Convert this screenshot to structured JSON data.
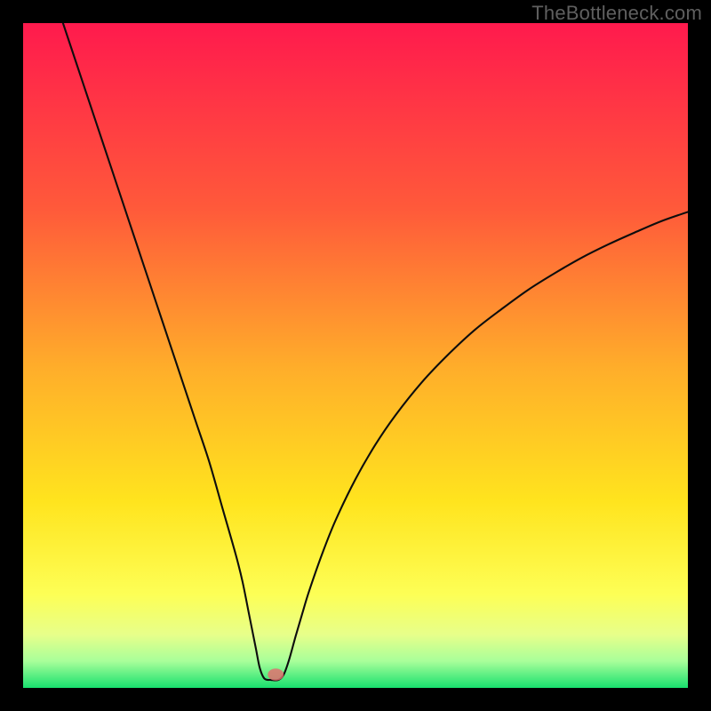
{
  "watermark": "TheBottleneck.com",
  "chart_data": {
    "type": "line",
    "title": "",
    "xlabel": "",
    "ylabel": "",
    "xlim": [
      0,
      100
    ],
    "ylim": [
      0,
      100
    ],
    "background_gradient_stops": [
      {
        "offset": 0,
        "color": "#ff1a4d"
      },
      {
        "offset": 28,
        "color": "#ff5a3a"
      },
      {
        "offset": 52,
        "color": "#ffae2a"
      },
      {
        "offset": 72,
        "color": "#ffe41e"
      },
      {
        "offset": 86,
        "color": "#fdff56"
      },
      {
        "offset": 92,
        "color": "#e7ff8a"
      },
      {
        "offset": 96,
        "color": "#a8ff9a"
      },
      {
        "offset": 100,
        "color": "#18e06e"
      }
    ],
    "minimum_x": 37,
    "marker": {
      "x": 38,
      "y": 2,
      "color": "#e07070",
      "rx": 1.2,
      "ry": 0.9
    },
    "series": [
      {
        "name": "curve",
        "color": "#0d0d0d",
        "width": 2.1,
        "points": [
          {
            "x": 6,
            "y": 100
          },
          {
            "x": 8,
            "y": 94
          },
          {
            "x": 10,
            "y": 88
          },
          {
            "x": 12,
            "y": 82
          },
          {
            "x": 14,
            "y": 76
          },
          {
            "x": 16,
            "y": 70
          },
          {
            "x": 18,
            "y": 64
          },
          {
            "x": 20,
            "y": 58
          },
          {
            "x": 22,
            "y": 52
          },
          {
            "x": 24,
            "y": 46
          },
          {
            "x": 26,
            "y": 40
          },
          {
            "x": 28,
            "y": 34
          },
          {
            "x": 30,
            "y": 27
          },
          {
            "x": 32,
            "y": 20
          },
          {
            "x": 33,
            "y": 16
          },
          {
            "x": 34,
            "y": 11
          },
          {
            "x": 35,
            "y": 6
          },
          {
            "x": 35.6,
            "y": 3
          },
          {
            "x": 36.3,
            "y": 1.4
          },
          {
            "x": 37.3,
            "y": 1.2
          },
          {
            "x": 38.4,
            "y": 1.2
          },
          {
            "x": 39.2,
            "y": 2.0
          },
          {
            "x": 40,
            "y": 4.2
          },
          {
            "x": 41,
            "y": 7.8
          },
          {
            "x": 42,
            "y": 11.2
          },
          {
            "x": 43,
            "y": 14.5
          },
          {
            "x": 45,
            "y": 20.2
          },
          {
            "x": 47,
            "y": 25.2
          },
          {
            "x": 50,
            "y": 31.4
          },
          {
            "x": 53,
            "y": 36.6
          },
          {
            "x": 56,
            "y": 41.0
          },
          {
            "x": 60,
            "y": 46.0
          },
          {
            "x": 64,
            "y": 50.2
          },
          {
            "x": 68,
            "y": 53.9
          },
          {
            "x": 72,
            "y": 57.0
          },
          {
            "x": 76,
            "y": 59.9
          },
          {
            "x": 80,
            "y": 62.4
          },
          {
            "x": 84,
            "y": 64.7
          },
          {
            "x": 88,
            "y": 66.7
          },
          {
            "x": 92,
            "y": 68.5
          },
          {
            "x": 96,
            "y": 70.2
          },
          {
            "x": 100,
            "y": 71.6
          }
        ]
      }
    ]
  }
}
